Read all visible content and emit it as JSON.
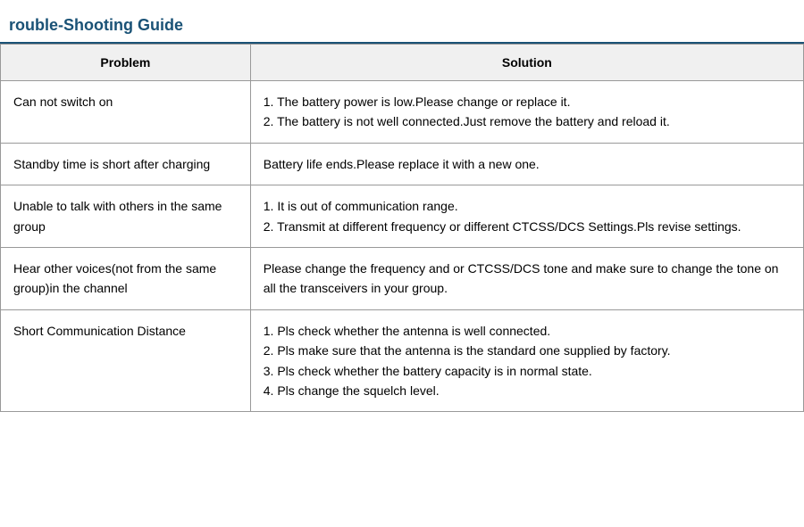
{
  "title": "rouble-Shooting Guide",
  "table": {
    "header": {
      "problem": "Problem",
      "solution": "Solution"
    },
    "rows": [
      {
        "problem": "Can not switch on",
        "solution": "1. The battery power is low.Please change or replace it.\n2. The battery is not well connected.Just remove the battery and reload it."
      },
      {
        "problem": "Standby time is short after charging",
        "solution": "Battery life ends.Please replace it with a new one."
      },
      {
        "problem": "Unable to talk with others in the same group",
        "solution": "1. It is out of communication range.\n2.  Transmit at different frequency or different CTCSS/DCS Settings.Pls revise settings."
      },
      {
        "problem": "Hear other voices(not from the same group)in the channel",
        "solution": "Please change the frequency and or CTCSS/DCS tone and make sure to change the tone on all the transceivers in your group."
      },
      {
        "problem": "Short Communication Distance",
        "solution": "1. Pls check whether the antenna is well connected.\n2. Pls make sure that the antenna is the standard one supplied by factory.\n3. Pls check whether the battery capacity is in normal state.\n4. Pls change the squelch level."
      }
    ]
  }
}
